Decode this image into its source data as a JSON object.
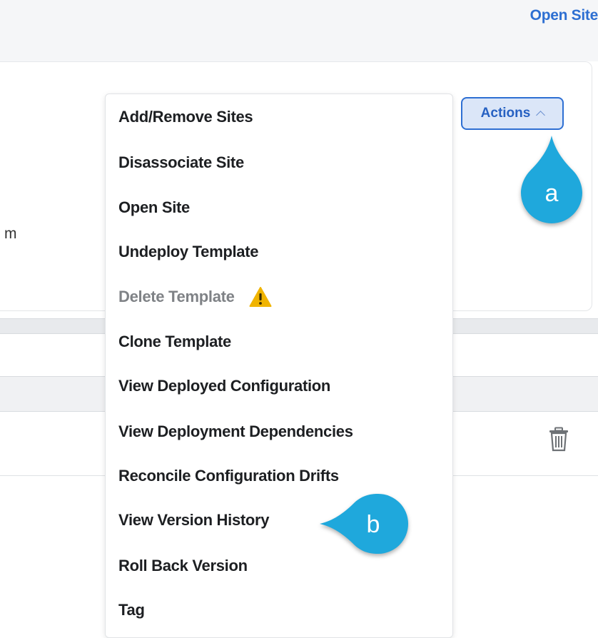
{
  "header": {
    "open_site_label": "Open Site"
  },
  "background": {
    "partial_text": "m"
  },
  "actions_button": {
    "label": "Actions",
    "expanded": true
  },
  "menu": {
    "items": [
      {
        "label": "Add/Remove Sites",
        "enabled": true
      },
      {
        "label": "Disassociate Site",
        "enabled": true
      },
      {
        "label": "Open Site",
        "enabled": true
      },
      {
        "label": "Undeploy Template",
        "enabled": true
      },
      {
        "label": "Delete Template",
        "enabled": false,
        "icon": "warning-icon"
      },
      {
        "label": "Clone Template",
        "enabled": true
      },
      {
        "label": "View Deployed Configuration",
        "enabled": true
      },
      {
        "label": "View Deployment Dependencies",
        "enabled": true
      },
      {
        "label": "Reconcile Configuration Drifts",
        "enabled": true
      },
      {
        "label": "View Version History",
        "enabled": true
      },
      {
        "label": "Roll Back Version",
        "enabled": true
      },
      {
        "label": "Tag",
        "enabled": true
      }
    ]
  },
  "callouts": {
    "a": "a",
    "b": "b"
  },
  "icons": {
    "row_delete": "trash-icon",
    "delete_warning": "warning-icon"
  },
  "colors": {
    "accent": "#2e6fd3",
    "callout": "#1fa8dc",
    "warning": "#f0b400",
    "disabled_text": "#7f8286"
  }
}
